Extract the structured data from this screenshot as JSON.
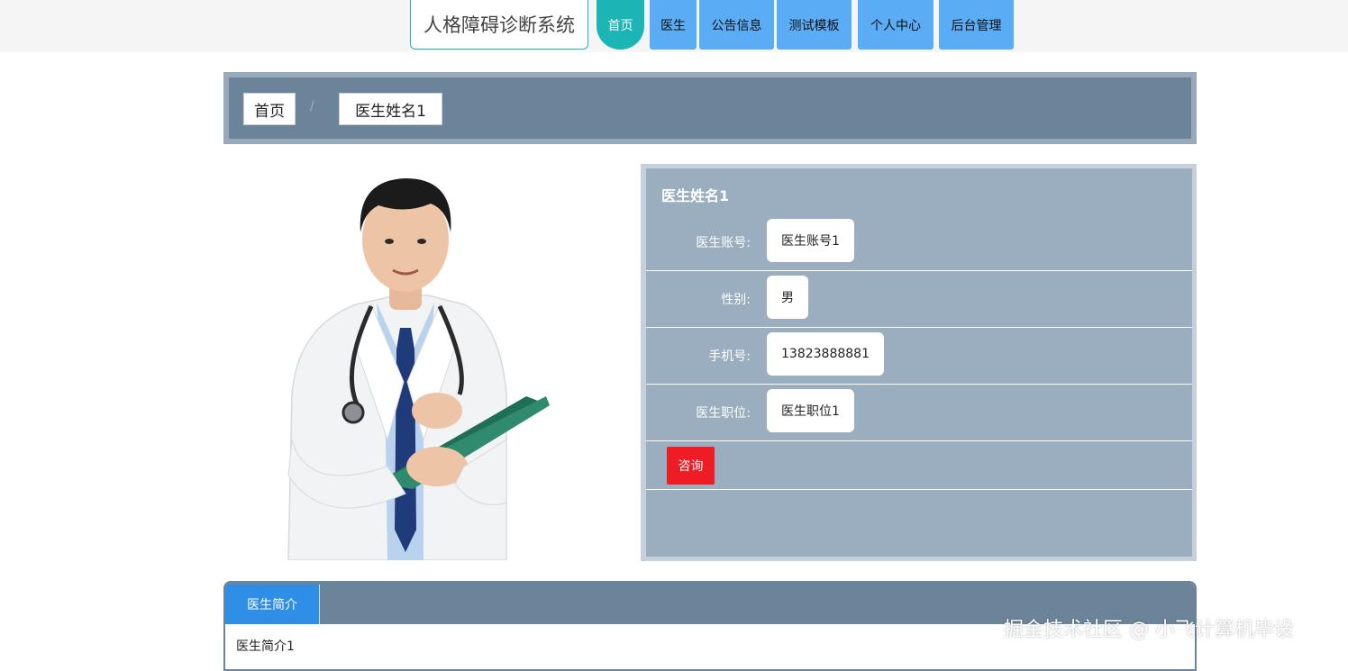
{
  "app": {
    "title": "人格障碍诊断系统"
  },
  "nav": {
    "items": [
      {
        "label": "首页",
        "active": true
      },
      {
        "label": "医生"
      },
      {
        "label": "公告信息"
      },
      {
        "label": "测试模板"
      },
      {
        "label": "个人中心"
      },
      {
        "label": "后台管理"
      }
    ]
  },
  "breadcrumb": {
    "home": "首页",
    "separator": "/",
    "current": "医生姓名1"
  },
  "doctor": {
    "name": "医生姓名1",
    "fields": [
      {
        "label": "医生账号:",
        "value": "医生账号1"
      },
      {
        "label": "性别:",
        "value": "男"
      },
      {
        "label": "手机号:",
        "value": "13823888881"
      },
      {
        "label": "医生职位:",
        "value": "医生职位1"
      }
    ],
    "consult_label": "咨询",
    "photo_icon": "doctor-photo"
  },
  "intro": {
    "tab_label": "医生简介",
    "text": "医生简介1"
  },
  "watermark": "掘金技术社区 @ 小飞计算机毕设",
  "colors": {
    "nav_active": "#1cb5b6",
    "nav_item": "#5aacf5",
    "panel": "#9aaebf",
    "bar": "#6b8499",
    "consult": "#ee1c25",
    "tab": "#2f8ee5"
  }
}
